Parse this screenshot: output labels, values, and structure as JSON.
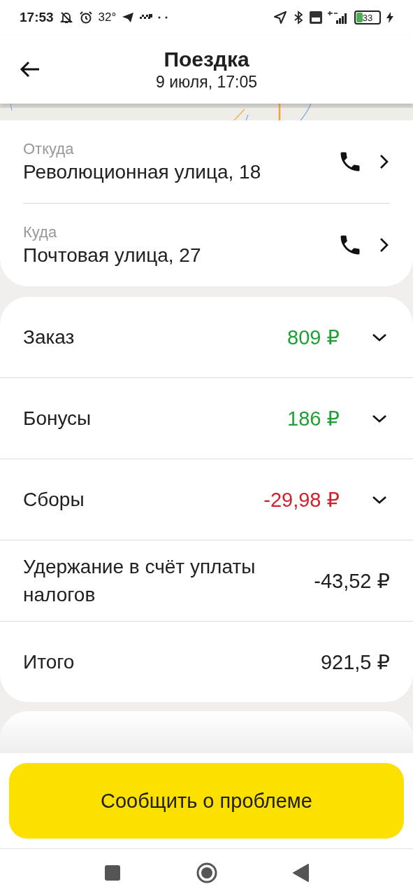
{
  "status_bar": {
    "time": "17:53",
    "temperature": "32°",
    "battery": "33"
  },
  "header": {
    "title": "Поездка",
    "subtitle": "9 июля, 17:05"
  },
  "route": [
    {
      "label": "Откуда",
      "address": "Революционная улица, 18"
    },
    {
      "label": "Куда",
      "address": "Почтовая улица, 27"
    }
  ],
  "payments": [
    {
      "label": "Заказ",
      "amount": "809 ₽",
      "color": "#21a038",
      "expandable": true
    },
    {
      "label": "Бонусы",
      "amount": "186 ₽",
      "color": "#21a038",
      "expandable": true
    },
    {
      "label": "Сборы",
      "amount": "-29,98 ₽",
      "color": "#d0222d",
      "expandable": true
    },
    {
      "label": "Удержание в счёт уплаты налогов",
      "amount": "-43,52 ₽",
      "color": "#21201f",
      "expandable": false
    },
    {
      "label": "Итого",
      "amount": "921,5 ₽",
      "color": "#21201f",
      "expandable": false
    }
  ],
  "report_button": "Сообщить о проблеме"
}
